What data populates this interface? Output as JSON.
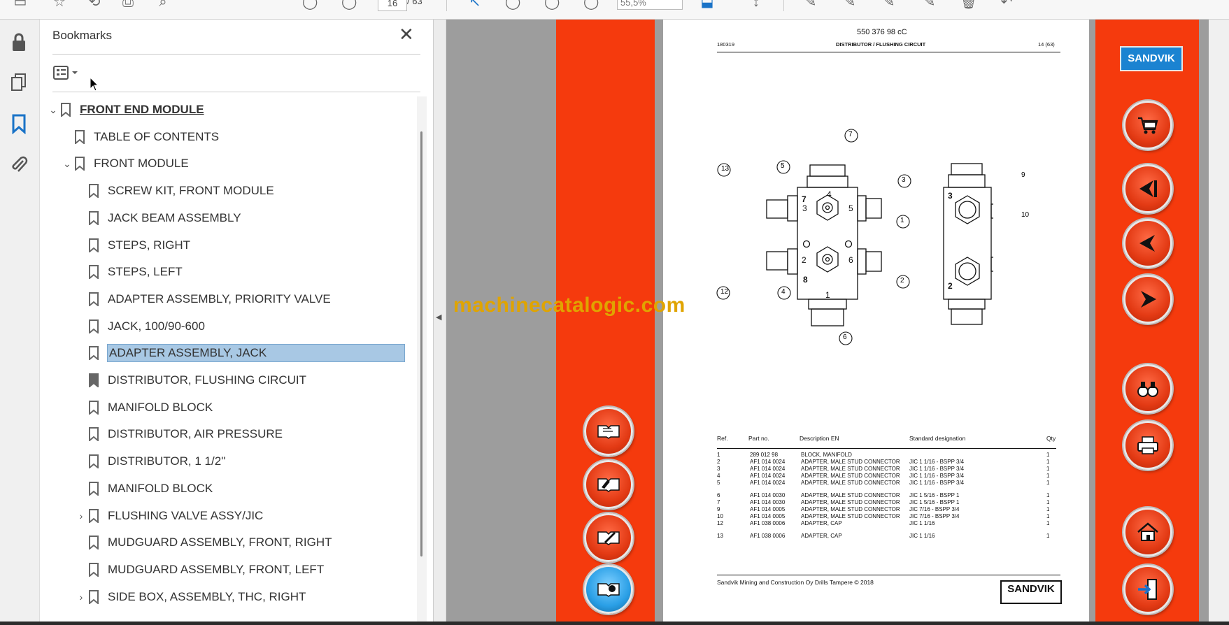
{
  "toolbar": {
    "page_current": "16",
    "page_total": "/ 63",
    "zoom": "55,5%"
  },
  "bookmarks_panel": {
    "title": "Bookmarks",
    "items": [
      {
        "label": "FRONT END MODULE",
        "level": 0,
        "expanded": true
      },
      {
        "label": "TABLE OF CONTENTS",
        "level": 1
      },
      {
        "label": "FRONT MODULE",
        "level": 1,
        "expanded": true
      },
      {
        "label": "SCREW KIT, FRONT MODULE",
        "level": 2
      },
      {
        "label": "JACK BEAM ASSEMBLY",
        "level": 2
      },
      {
        "label": "STEPS, RIGHT",
        "level": 2
      },
      {
        "label": "STEPS, LEFT",
        "level": 2
      },
      {
        "label": "ADAPTER ASSEMBLY, PRIORITY VALVE",
        "level": 2
      },
      {
        "label": "JACK, 100/90-600",
        "level": 2
      },
      {
        "label": "ADAPTER ASSEMBLY, JACK",
        "level": 2,
        "selected": true
      },
      {
        "label": "DISTRIBUTOR, FLUSHING CIRCUIT",
        "level": 2,
        "current": true
      },
      {
        "label": "MANIFOLD BLOCK",
        "level": 2
      },
      {
        "label": "DISTRIBUTOR, AIR PRESSURE",
        "level": 2
      },
      {
        "label": "DISTRIBUTOR, 1 1/2''",
        "level": 2
      },
      {
        "label": "MANIFOLD BLOCK",
        "level": 2
      },
      {
        "label": "FLUSHING VALVE ASSY/JIC",
        "level": 2,
        "collapsed": true
      },
      {
        "label": "MUDGUARD ASSEMBLY, FRONT, RIGHT",
        "level": 2
      },
      {
        "label": "MUDGUARD ASSEMBLY, FRONT, LEFT",
        "level": 2
      },
      {
        "label": "SIDE BOX, ASSEMBLY, THC, RIGHT",
        "level": 2,
        "collapsed": true
      }
    ]
  },
  "watermark": "machinecatalogic.com",
  "brand": "SANDVIK",
  "document": {
    "part_number": "550 376 98 cC",
    "date_code": "180319",
    "title": "DISTRIBUTOR / FLUSHING CIRCUIT",
    "page": "14 (63)",
    "table_headers": [
      "Ref.",
      "Part no.",
      "Description EN",
      "Standard designation",
      "Qty"
    ],
    "rows": [
      [
        "1",
        "289 012 98",
        "BLOCK, MANIFOLD",
        "",
        "1"
      ],
      [
        "2",
        "AF1 014 0024",
        "ADAPTER, MALE STUD CONNECTOR",
        "JIC 1 1/16 - BSPP 3/4",
        "1"
      ],
      [
        "3",
        "AF1 014 0024",
        "ADAPTER, MALE STUD CONNECTOR",
        "JIC 1 1/16 - BSPP 3/4",
        "1"
      ],
      [
        "4",
        "AF1 014 0024",
        "ADAPTER, MALE STUD CONNECTOR",
        "JIC 1 1/16 - BSPP 3/4",
        "1"
      ],
      [
        "5",
        "AF1 014 0024",
        "ADAPTER, MALE STUD CONNECTOR",
        "JIC 1 1/16 - BSPP 3/4",
        "1"
      ],
      [
        "6",
        "AF1 014 0030",
        "ADAPTER, MALE STUD CONNECTOR",
        "JIC 1 5/16 - BSPP 1",
        "1"
      ],
      [
        "7",
        "AF1 014 0030",
        "ADAPTER, MALE STUD CONNECTOR",
        "JIC 1 5/16 - BSPP 1",
        "1"
      ],
      [
        "9",
        "AF1 014 0005",
        "ADAPTER, MALE STUD CONNECTOR",
        "JIC 7/16 - BSPP 3/4",
        "1"
      ],
      [
        "10",
        "AF1 014 0005",
        "ADAPTER, MALE STUD CONNECTOR",
        "JIC 7/16 - BSPP 3/4",
        "1"
      ],
      [
        "12",
        "AF1 038 0006",
        "ADAPTER, CAP",
        "JIC 1 1/16",
        "1"
      ],
      [
        "13",
        "AF1 038 0006",
        "ADAPTER, CAP",
        "JIC 1 1/16",
        "1"
      ]
    ],
    "footer": "Sandvik Mining and Construction Oy Drills Tampere © 2018",
    "footer_logo": "SANDVIK",
    "callouts": [
      "7",
      "13",
      "5",
      "3",
      "1",
      "9",
      "10",
      "12",
      "4",
      "2",
      "6"
    ],
    "port_labels": [
      "4",
      "7",
      "3",
      "5",
      "2",
      "6",
      "8",
      "1",
      "3",
      "2"
    ]
  },
  "colors": {
    "band_red": "#f53a0d",
    "selection": "#a8c8e4",
    "brand_blue": "#1b83d1"
  }
}
